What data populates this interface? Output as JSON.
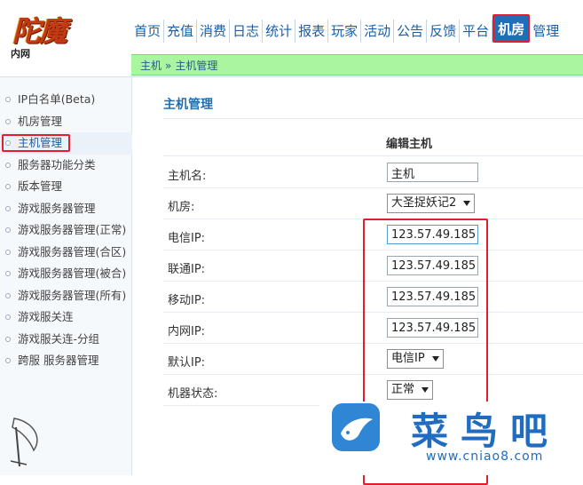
{
  "logo": {
    "mark": "陀魔",
    "sub": "内网"
  },
  "topnav": [
    {
      "label": "首页"
    },
    {
      "label": "充值"
    },
    {
      "label": "消费"
    },
    {
      "label": "日志"
    },
    {
      "label": "统计"
    },
    {
      "label": "报表"
    },
    {
      "label": "玩家"
    },
    {
      "label": "活动"
    },
    {
      "label": "公告"
    },
    {
      "label": "反馈"
    },
    {
      "label": "平台"
    },
    {
      "label": "机房"
    },
    {
      "label": "管理"
    }
  ],
  "active_nav": "机房",
  "breadcrumb": {
    "home": "主机",
    "sep": "»",
    "current": "主机管理"
  },
  "sidebar": {
    "items": [
      {
        "label": "IP白名单(Beta)"
      },
      {
        "label": "机房管理"
      },
      {
        "label": "主机管理"
      },
      {
        "label": "服务器功能分类"
      },
      {
        "label": "版本管理"
      },
      {
        "label": "游戏服务器管理"
      },
      {
        "label": "游戏服务器管理(正常)"
      },
      {
        "label": "游戏服务器管理(合区)"
      },
      {
        "label": "游戏服务器管理(被合)"
      },
      {
        "label": "游戏服务器管理(所有)"
      },
      {
        "label": "游戏服关连"
      },
      {
        "label": "游戏服关连-分组"
      },
      {
        "label": "跨服 服务器管理"
      }
    ],
    "active_index": 2
  },
  "main": {
    "title": "主机管理",
    "form_title": "编辑主机",
    "fields": [
      {
        "label": "主机名:",
        "value": "主机"
      },
      {
        "label": "机房:",
        "value": "大圣捉妖记2"
      },
      {
        "label": "电信IP:",
        "value": "123.57.49.185"
      },
      {
        "label": "联通IP:",
        "value": "123.57.49.185"
      },
      {
        "label": "移动IP:",
        "value": "123.57.49.185"
      },
      {
        "label": "内网IP:",
        "value": "123.57.49.185"
      },
      {
        "label": "默认IP:",
        "value": "电信IP"
      },
      {
        "label": "机器状态:",
        "value": "正常"
      }
    ]
  },
  "watermark": {
    "text": "菜鸟吧",
    "url": "www.cniao8.com"
  },
  "colors": {
    "accent": "#1f6fb7",
    "highlight": "#e21d2d",
    "subbar": "#a9f5a0"
  }
}
